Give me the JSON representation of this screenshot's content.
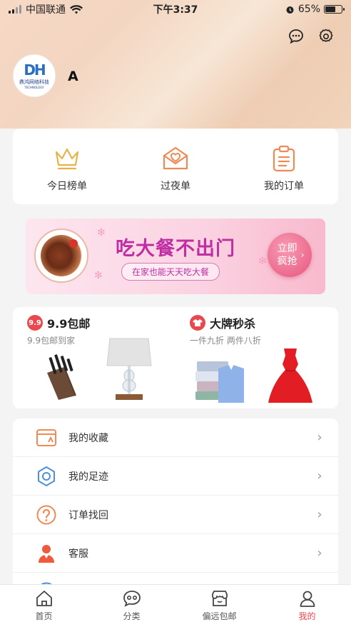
{
  "status_bar": {
    "carrier": "中国联通",
    "time": "下午3:37",
    "battery": "65%",
    "battery_level": 0.65
  },
  "header": {
    "username": "A",
    "logo_letters": "DH",
    "logo_cn": "鼎鸿网络科技",
    "logo_en": "TECHNOLOGY"
  },
  "orders": [
    {
      "label": "今日榜单",
      "icon": "crown-icon"
    },
    {
      "label": "过夜单",
      "icon": "envelope-heart-icon"
    },
    {
      "label": "我的订单",
      "icon": "clipboard-icon"
    }
  ],
  "banner": {
    "title": "吃大餐不出门",
    "subtitle": "在家也能天天吃大餐",
    "cta": "立即疯抢"
  },
  "promo": {
    "left": {
      "badge": "9.9",
      "title": "9.9包邮",
      "desc": "9.9包邮到家"
    },
    "right": {
      "title": "大牌秒杀",
      "desc": "一件九折  两件八折"
    }
  },
  "menu": [
    {
      "label": "我的收藏",
      "icon": "favorites-icon"
    },
    {
      "label": "我的足迹",
      "icon": "footprint-icon"
    },
    {
      "label": "订单找回",
      "icon": "question-icon"
    },
    {
      "label": "客服",
      "icon": "customer-service-icon"
    }
  ],
  "tabs": [
    {
      "label": "首页",
      "icon": "home-icon"
    },
    {
      "label": "分类",
      "icon": "category-icon"
    },
    {
      "label": "偏远包邮",
      "icon": "shop-icon"
    },
    {
      "label": "我的",
      "icon": "profile-icon",
      "active": true
    }
  ],
  "colors": {
    "accent": "#e8484e",
    "icon_orange": "#ef8a55",
    "icon_blue": "#4d8fe0",
    "icon_gold": "#e8b24a"
  }
}
